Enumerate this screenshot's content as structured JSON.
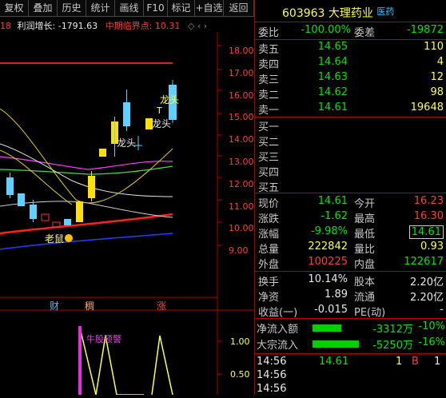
{
  "toolbar": [
    "复权",
    "叠加",
    "历史",
    "统计",
    "画线",
    "F10",
    "标记",
    "+自选",
    "返回"
  ],
  "indicator": {
    "prefix": "18",
    "label": "利润增长:",
    "value": "-1791.63",
    "crit_label": "中期临界点:",
    "crit_value": "10.31"
  },
  "price_axis": [
    "18.00",
    "17.00",
    "16.00",
    "15.00",
    "14.00",
    "13.00",
    "12.00",
    "11.00",
    "10.00",
    "9.00"
  ],
  "lower_axis": [
    "1.00",
    "0.50"
  ],
  "chart_notes": {
    "longtou1": "龙头",
    "longtou2": "龙头",
    "longtou3": "龙头",
    "laoshu": "老鼠",
    "top_mark": "T",
    "warning": "牛股预警"
  },
  "events": {
    "cai": "财",
    "chou": "稠",
    "zhang": "涨"
  },
  "stock": {
    "code": "603963",
    "name": "大理药业",
    "tag": "医药"
  },
  "weibi": {
    "l1": "委比",
    "v1": "-100.00%",
    "l2": "委差",
    "v2": "-19872"
  },
  "asks": [
    {
      "label": "卖五",
      "price": "14.65",
      "vol": "110"
    },
    {
      "label": "卖四",
      "price": "14.64",
      "vol": "4"
    },
    {
      "label": "卖三",
      "price": "14.63",
      "vol": "12"
    },
    {
      "label": "卖二",
      "price": "14.62",
      "vol": "98"
    },
    {
      "label": "卖一",
      "price": "14.61",
      "vol": "19648"
    }
  ],
  "bids": [
    {
      "label": "买一",
      "price": "",
      "vol": ""
    },
    {
      "label": "买二",
      "price": "",
      "vol": ""
    },
    {
      "label": "买三",
      "price": "",
      "vol": ""
    },
    {
      "label": "买四",
      "price": "",
      "vol": ""
    },
    {
      "label": "买五",
      "price": "",
      "vol": ""
    }
  ],
  "quote": [
    {
      "l1": "现价",
      "v1": "14.61",
      "l2": "今开",
      "v2": "16.23"
    },
    {
      "l1": "涨跌",
      "v1": "-1.62",
      "l2": "最高",
      "v2": "16.30"
    },
    {
      "l1": "涨幅",
      "v1": "-9.98%",
      "l2": "最低",
      "v2": "14.61"
    },
    {
      "l1": "总量",
      "v1": "222842",
      "l2": "量比",
      "v2": "0.93"
    },
    {
      "l1": "外盘",
      "v1": "100225",
      "l2": "内盘",
      "v2": "122617"
    }
  ],
  "stats": [
    {
      "l1": "换手",
      "v1": "10.14%",
      "l2": "股本",
      "v2": "2.20亿"
    },
    {
      "l1": "净资",
      "v1": "1.89",
      "l2": "流通",
      "v2": "2.20亿"
    },
    {
      "l1": "收益(一)",
      "v1": "-0.015",
      "l2": "PE(动)",
      "v2": "-"
    }
  ],
  "flows": [
    {
      "label": "净流入额",
      "amount": "-3312万",
      "pct": "-10%"
    },
    {
      "label": "大宗流入",
      "amount": "-5250万",
      "pct": "-16%"
    }
  ],
  "ticks": [
    {
      "time": "14:56",
      "price": "14.61",
      "vol": "1",
      "side": "B",
      "num": "1"
    },
    {
      "time": "14:56",
      "price": "",
      "vol": "",
      "side": "",
      "num": ""
    },
    {
      "time": "14:56",
      "price": "",
      "vol": "",
      "side": "",
      "num": ""
    }
  ]
}
